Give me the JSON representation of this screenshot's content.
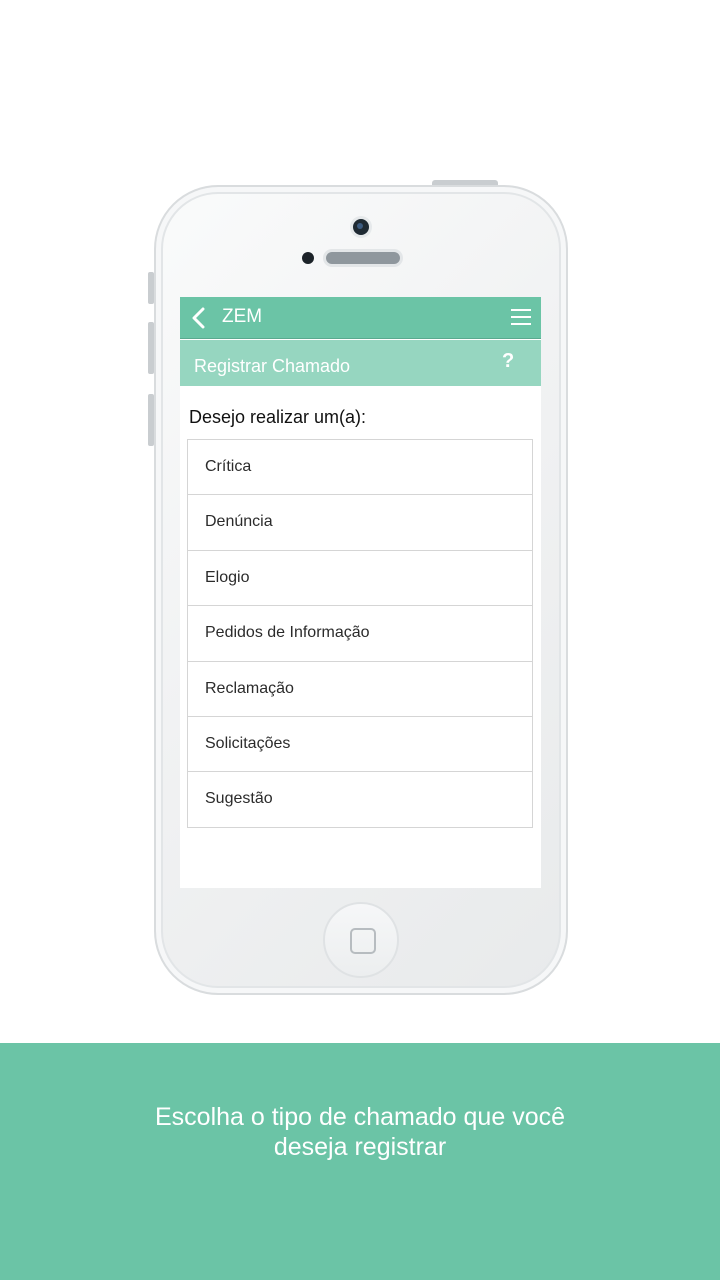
{
  "app": {
    "title": "ZEM",
    "accent_color": "#6bc4a6",
    "subheader_color": "#96d6c0"
  },
  "toolbar": {
    "back_icon": "chevron-left-icon",
    "menu_icon": "hamburger-menu-icon"
  },
  "subheader": {
    "title": "Registrar Chamado",
    "help_label": "?"
  },
  "form": {
    "prompt": "Desejo realizar um(a):",
    "options": [
      {
        "label": "Crítica"
      },
      {
        "label": "Denúncia"
      },
      {
        "label": "Elogio"
      },
      {
        "label": "Pedidos de Informação"
      },
      {
        "label": "Reclamação"
      },
      {
        "label": "Solicitações"
      },
      {
        "label": "Sugestão"
      }
    ]
  },
  "caption": {
    "line1": "Escolha o tipo de chamado que você",
    "line2": "deseja registrar"
  }
}
